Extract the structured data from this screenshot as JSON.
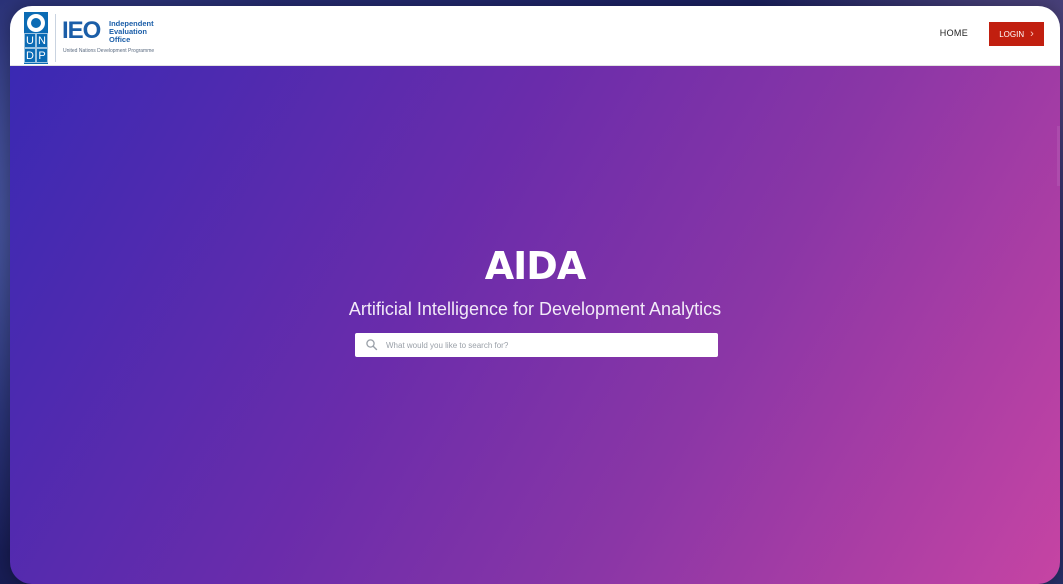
{
  "header": {
    "undp_letters": [
      "U",
      "N",
      "D",
      "P"
    ],
    "ieo_mark": "IEO",
    "ieo_name_lines": [
      "Independent",
      "Evaluation",
      "Office"
    ],
    "ieo_subtext": "United Nations Development Programme",
    "nav": {
      "home_label": "HOME"
    },
    "login": {
      "label": "LOGIN",
      "arrow_icon": "chevron-right-icon"
    }
  },
  "hero": {
    "title": "AIDA",
    "subtitle": "Artificial Intelligence for Development Analytics",
    "search": {
      "placeholder": "What would you like to search for?",
      "value": "",
      "icon": "search-icon"
    }
  },
  "colors": {
    "brand_blue": "#1b5ea8",
    "login_red": "#c11f0f",
    "hero_gradient_start": "#3a29b3",
    "hero_gradient_end": "#c644a3"
  }
}
